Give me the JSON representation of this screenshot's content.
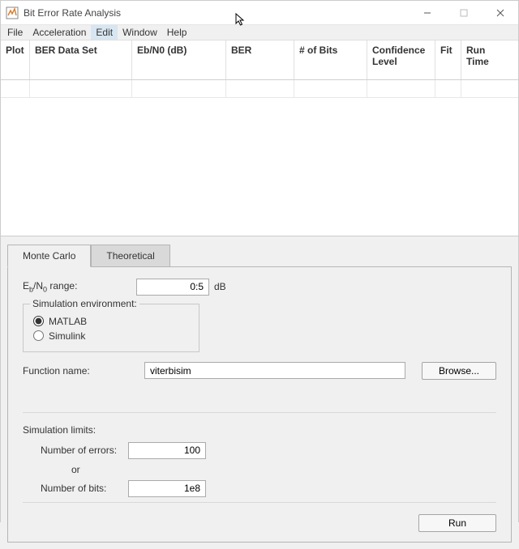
{
  "window": {
    "title": "Bit Error Rate Analysis"
  },
  "menu": {
    "items": [
      "File",
      "Acceleration",
      "Edit",
      "Window",
      "Help"
    ]
  },
  "table": {
    "columns": [
      "Plot",
      "BER Data Set",
      "Eb/N0 (dB)",
      "BER",
      "# of Bits",
      "Confidence Level",
      "Fit",
      "Run Time"
    ],
    "widths": [
      36,
      126,
      116,
      84,
      90,
      84,
      32,
      66
    ]
  },
  "tabs": {
    "items": [
      "Monte Carlo",
      "Theoretical"
    ],
    "active": 0
  },
  "monteCarlo": {
    "ebn0": {
      "labelPrefix": "E",
      "labelSub1": "b",
      "labelMid": "/N",
      "labelSub2": "0",
      "labelSuffix": " range:",
      "value": "0:5",
      "unit": "dB"
    },
    "simEnv": {
      "legend": "Simulation environment:",
      "options": [
        "MATLAB",
        "Simulink"
      ],
      "selected": 0
    },
    "functionName": {
      "label": "Function name:",
      "value": "viterbisim",
      "browse": "Browse..."
    },
    "limits": {
      "label": "Simulation limits:",
      "errors": {
        "label": "Number of errors:",
        "value": "100"
      },
      "or": "or",
      "bits": {
        "label": "Number of bits:",
        "value": "1e8"
      }
    },
    "run": "Run"
  }
}
